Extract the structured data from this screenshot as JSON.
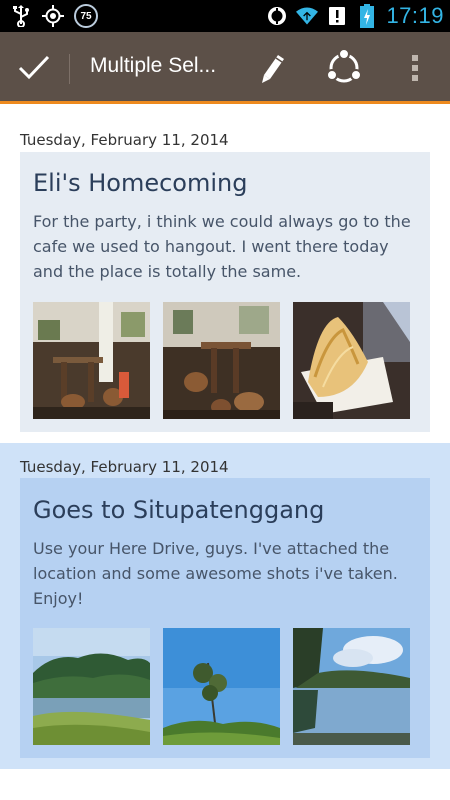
{
  "status_bar": {
    "time": "17:19",
    "battery_badge": "75",
    "icons": [
      "usb-icon",
      "gps-icon",
      "battery-level-badge",
      "sync-icon",
      "wifi-icon",
      "notification-icon",
      "battery-icon"
    ]
  },
  "action_bar": {
    "title": "Multiple Sel...",
    "icons": [
      "checkmark-icon",
      "edit-pencil-icon",
      "share-icon",
      "overflow-menu-icon"
    ],
    "accent_color": "#ee8a1e",
    "background_color": "#5c5048"
  },
  "entries": [
    {
      "date": "Tuesday, February 11, 2014",
      "title": "Eli's Homecoming",
      "body": "For the party, i think we could always go to the cafe we used to hangout. I went there today and the place is totally the same.",
      "selected": false,
      "photos": [
        "cafe-interior-photo",
        "cafe-tables-photo",
        "fried-food-photo"
      ]
    },
    {
      "date": "Tuesday, February 11, 2014",
      "title": "Goes to Situpatenggang",
      "body": "Use your Here Drive, guys. I've attached the location and some awesome shots i've taken. Enjoy!",
      "selected": true,
      "photos": [
        "lake-forest-photo",
        "tree-sky-photo",
        "lake-reflection-photo"
      ]
    }
  ]
}
